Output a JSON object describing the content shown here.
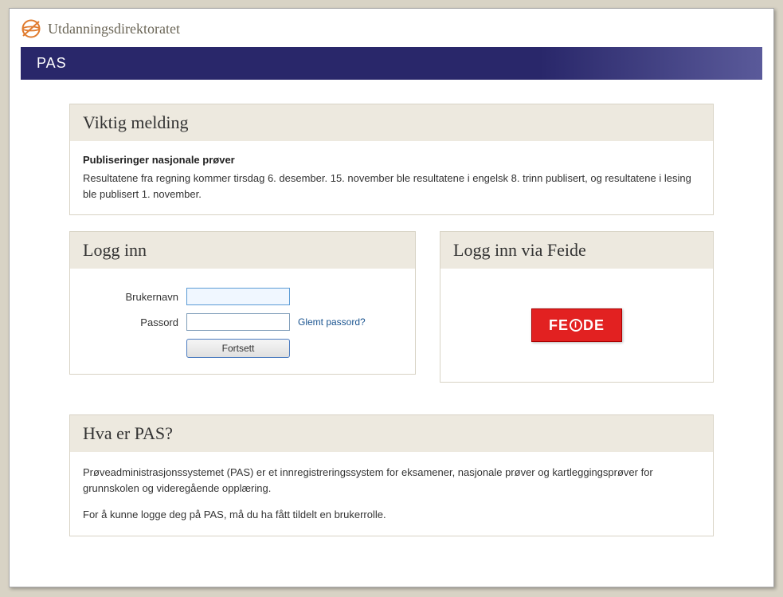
{
  "header": {
    "org_name": "Utdanningsdirektoratet"
  },
  "nav": {
    "title": "PAS"
  },
  "alert": {
    "title": "Viktig melding",
    "subheading": "Publiseringer nasjonale prøver",
    "body": "Resultatene fra regning kommer tirsdag 6. desember. 15. november ble resultatene i engelsk 8. trinn publisert, og resultatene i lesing ble publisert 1. november."
  },
  "login": {
    "title": "Logg inn",
    "username_label": "Brukernavn",
    "username_value": "",
    "password_label": "Passord",
    "password_value": "",
    "forgot_label": "Glemt passord?",
    "submit_label": "Fortsett"
  },
  "feide": {
    "title": "Logg inn via Feide",
    "button_label": "FEIDE"
  },
  "about": {
    "title": "Hva er PAS?",
    "p1": "Prøveadministrasjonssystemet (PAS) er et innregistreringssystem for eksamener, nasjonale prøver og kartleggingsprøver for grunnskolen og videregående opplæring.",
    "p2": "For å kunne logge deg på PAS, må du ha fått tildelt en brukerrolle."
  }
}
